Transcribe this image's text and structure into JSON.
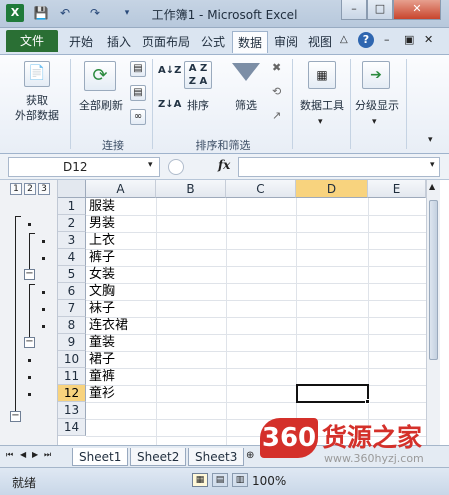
{
  "window": {
    "title": "工作簿1 - Microsoft Excel"
  },
  "ribbon_tabs": [
    "文件",
    "开始",
    "插入",
    "页面布局",
    "公式",
    "数据",
    "审阅",
    "视图"
  ],
  "active_tab": "数据",
  "ribbon": {
    "get_external": "获取\n外部数据",
    "refresh_all": "全部刷新",
    "group_connect": "连接",
    "sort": "排序",
    "filter": "筛选",
    "group_sort": "排序和筛选",
    "data_tools": "数据工具",
    "outline": "分级显示"
  },
  "formula_bar": {
    "name_box": "D12",
    "fx": "fx",
    "value": ""
  },
  "outline_levels": [
    "1",
    "2",
    "3"
  ],
  "columns": [
    "A",
    "B",
    "C",
    "D",
    "E"
  ],
  "selected_column": "D",
  "rows": [
    {
      "n": "1",
      "a": "服装"
    },
    {
      "n": "2",
      "a": "男装"
    },
    {
      "n": "3",
      "a": "上衣"
    },
    {
      "n": "4",
      "a": "裤子"
    },
    {
      "n": "5",
      "a": "女装"
    },
    {
      "n": "6",
      "a": "文胸"
    },
    {
      "n": "7",
      "a": "袜子"
    },
    {
      "n": "8",
      "a": "连衣裙"
    },
    {
      "n": "9",
      "a": "童装"
    },
    {
      "n": "10",
      "a": "裙子"
    },
    {
      "n": "11",
      "a": "童裤"
    },
    {
      "n": "12",
      "a": "童衫"
    },
    {
      "n": "13",
      "a": ""
    },
    {
      "n": "14",
      "a": ""
    }
  ],
  "selected_row": "12",
  "sheet_tabs": [
    "Sheet1",
    "Sheet2",
    "Sheet3"
  ],
  "active_sheet": "Sheet1",
  "status": {
    "ready": "就绪",
    "zoom": "100%"
  },
  "watermark": {
    "logo": "360",
    "name": "货源之家",
    "url": "www.360hyzj.com"
  }
}
